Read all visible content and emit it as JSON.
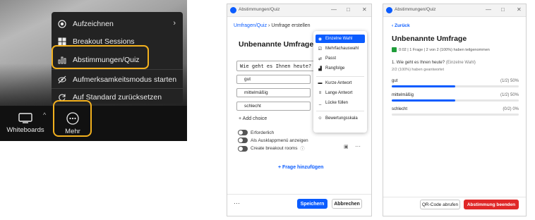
{
  "meeting_menu": {
    "items": [
      {
        "label": "Aufzeichnen",
        "icon": "record-icon"
      },
      {
        "label": "Breakout Sessions",
        "icon": "breakout-icon"
      },
      {
        "label": "Abstimmungen/Quiz",
        "icon": "poll-icon"
      },
      {
        "label": "Aufmerksamkeitsmodus starten",
        "icon": "focus-mode-icon"
      },
      {
        "label": "Auf Standard zurücksetzen",
        "icon": "reset-icon"
      }
    ]
  },
  "toolbar": {
    "whiteboards_label": "Whiteboards",
    "more_label": "Mehr"
  },
  "create_poll": {
    "window_title": "Abstimmungen/Quiz",
    "breadcrumb_link": "Umfragen/Quiz",
    "breadcrumb_separator": "›",
    "breadcrumb_current": "Umfrage erstellen",
    "poll_title": "Unbenannte Umfrage",
    "question_value": "Wie geht es Ihnen heute?",
    "choices": [
      "gut",
      "mittelmäßig",
      "schlecht"
    ],
    "add_choice": "+ Add choice",
    "toggles": [
      "Erforderlich",
      "Als Ausklappmenü anzeigen",
      "Create breakout rooms"
    ],
    "add_question": "+  Frage hinzufügen",
    "more": "···",
    "save": "Speichern",
    "cancel": "Abbrechen",
    "question_types": [
      {
        "label": "Einzelne Wahl",
        "icon": "radio-icon",
        "selected": true
      },
      {
        "label": "Mehrfachauswahl",
        "icon": "checkbox-icon",
        "selected": false
      },
      {
        "label": "Passt",
        "icon": "match-icon",
        "selected": false
      },
      {
        "label": "Rangfolge",
        "icon": "rank-icon",
        "selected": false
      },
      {
        "label": "Kurze Antwort",
        "icon": "short-answer-icon",
        "selected": false
      },
      {
        "label": "Lange Antwort",
        "icon": "long-answer-icon",
        "selected": false
      },
      {
        "label": "Lücke füllen",
        "icon": "fill-blank-icon",
        "selected": false
      },
      {
        "label": "Bewertungsskala",
        "icon": "rating-icon",
        "selected": false
      }
    ]
  },
  "poll_results": {
    "window_title": "Abstimmungen/Quiz",
    "back": "‹ Zurück",
    "poll_title": "Unbenannte Umfrage",
    "meta": "0:02 | 1 Frage | 2 von 2 (100%) haben teilgenommen",
    "question": "1. Wie geht es Ihnen heute?",
    "question_type": "(Einzelne Wahl)",
    "answered": "2/2 (100%) haben geantwortet",
    "answers": [
      {
        "label": "gut",
        "result": "(1/2) 50%",
        "fraction": 0.5
      },
      {
        "label": "mittelmäßig",
        "result": "(1/2) 50%",
        "fraction": 0.5
      },
      {
        "label": "schlecht",
        "result": "(0/2) 0%",
        "fraction": 0
      }
    ],
    "qr_button": "QR-Code abrufen",
    "end_button": "Abstimmung beenden"
  },
  "colors": {
    "accent": "#0b5cff",
    "highlight": "#f2b01e",
    "danger": "#e02828"
  }
}
